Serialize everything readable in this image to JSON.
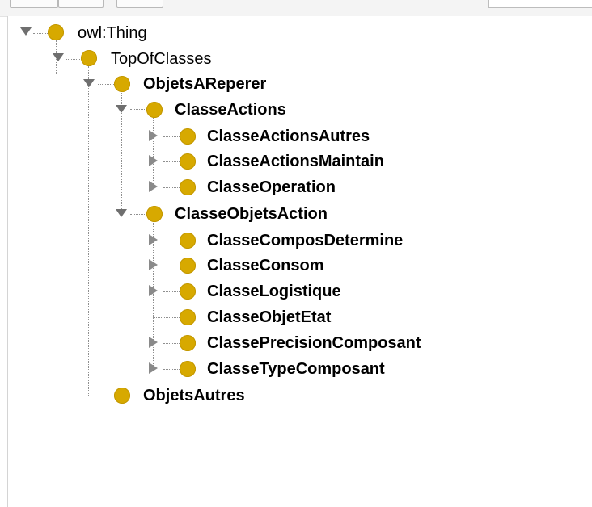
{
  "tree": {
    "root": {
      "label": "owl:Thing",
      "expanded": true,
      "icon": "owl-class-icon"
    },
    "top_of_classes": {
      "label": "TopOfClasses",
      "expanded": true
    },
    "objets_a_reperer": {
      "label": "ObjetsAReperer",
      "expanded": true
    },
    "classe_actions": {
      "label": "ClasseActions",
      "expanded": true,
      "children": [
        {
          "label": "ClasseActionsAutres",
          "has_children": true
        },
        {
          "label": "ClasseActionsMaintain",
          "has_children": true
        },
        {
          "label": "ClasseOperation",
          "has_children": true
        }
      ]
    },
    "classe_objets_action": {
      "label": "ClasseObjetsAction",
      "expanded": true,
      "children": [
        {
          "label": "ClasseComposDetermine",
          "has_children": true
        },
        {
          "label": "ClasseConsom",
          "has_children": true
        },
        {
          "label": "ClasseLogistique",
          "has_children": true
        },
        {
          "label": "ClasseObjetEtat",
          "has_children": false
        },
        {
          "label": "ClassePrecisionComposant",
          "has_children": true
        },
        {
          "label": "ClasseTypeComposant",
          "has_children": true
        }
      ]
    },
    "objets_autres": {
      "label": "ObjetsAutres",
      "expanded": false
    }
  },
  "colors": {
    "class_icon": "#d7a900",
    "toggle": "#6f6f6f",
    "guide_line": "#8f8f8f"
  }
}
